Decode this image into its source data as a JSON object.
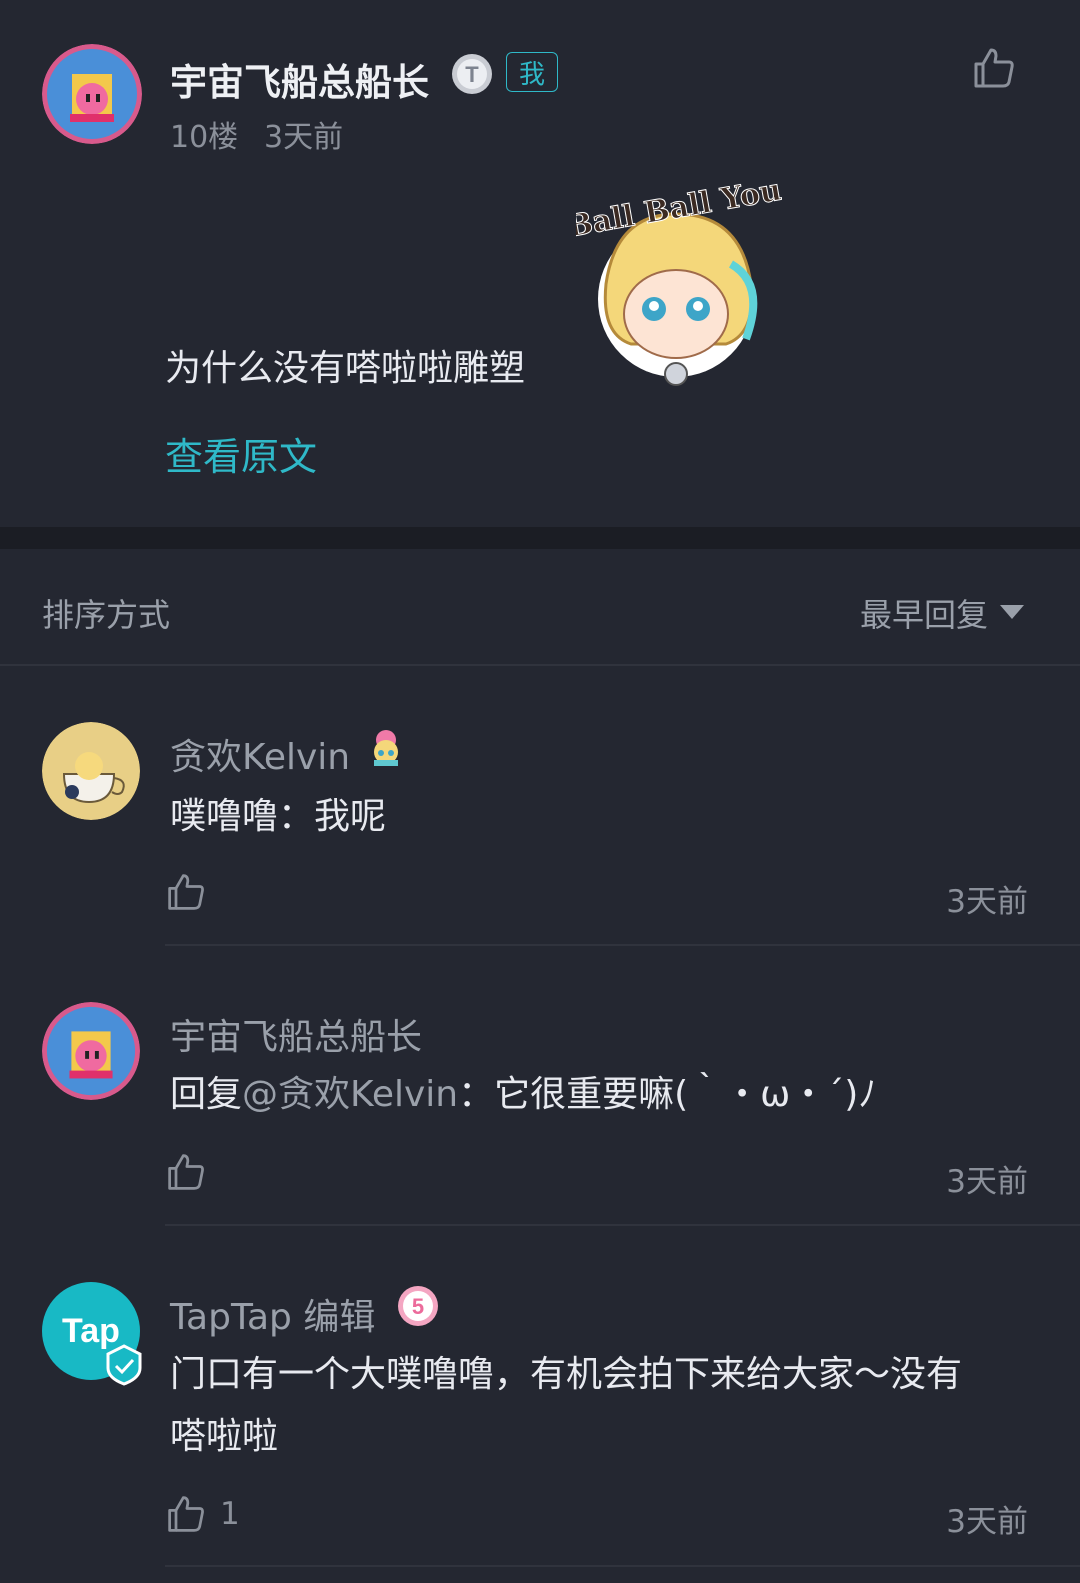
{
  "post": {
    "author": "宇宙飞船总船长",
    "me_badge": "我",
    "floor": "10楼",
    "time": "3天前",
    "text": "为什么没有嗒啦啦雕塑",
    "sticker_text": "Ball Ball You",
    "view_original": "查看原文"
  },
  "sort": {
    "label": "排序方式",
    "value": "最早回复"
  },
  "replies": [
    {
      "author": "贪欢Kelvin",
      "text": "噗噜噜：我呢",
      "time": "3天前"
    },
    {
      "author": "宇宙飞船总船长",
      "reply_prefix": "回复",
      "mention": "@贪欢Kelvin",
      "text": "：它很重要嘛(｀・ω・´)ﾉ",
      "time": "3天前"
    },
    {
      "author": "TapTap 编辑",
      "avatar_text": "Tap",
      "badge_icon": "5",
      "text_line1": "门口有一个大噗噜噜，有机会拍下来给大家～没有",
      "text_line2": "嗒啦啦",
      "likes": "1",
      "time": "3天前"
    }
  ],
  "colors": {
    "background": "#242731",
    "accent": "#2fb9c8",
    "divider": "#1b1d24"
  }
}
